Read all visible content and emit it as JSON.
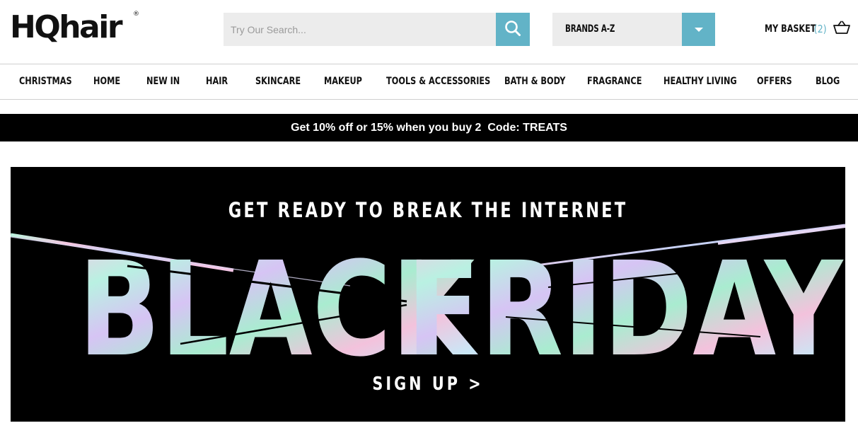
{
  "header": {
    "logo_text": "HQhair",
    "logo_mark": "®",
    "search_placeholder": "Try Our Search...",
    "search_icon": "search-icon",
    "brands_label": "BRANDS A-Z",
    "brands_icon": "chevron-down-icon",
    "basket_label": "MY BASKET",
    "basket_count": "(2)",
    "basket_icon": "basket-icon"
  },
  "nav": {
    "items": [
      {
        "label": "CHRISTMAS"
      },
      {
        "label": "HOME"
      },
      {
        "label": "NEW IN"
      },
      {
        "label": "HAIR"
      },
      {
        "label": "SKINCARE"
      },
      {
        "label": "MAKEUP"
      },
      {
        "label": "TOOLS & ACCESSORIES"
      },
      {
        "label": "BATH & BODY"
      },
      {
        "label": "FRAGRANCE"
      },
      {
        "label": "HEALTHY LIVING"
      },
      {
        "label": "OFFERS"
      },
      {
        "label": "BLOG"
      }
    ]
  },
  "promo": {
    "text": "Get 10% off or 15% when you buy 2  Code: TREATS"
  },
  "hero": {
    "tagline": "GET READY TO BREAK THE INTERNET",
    "headline_word1": "BLACK",
    "headline_word2": "FRIDAY",
    "signup_label": "SIGN UP >"
  },
  "colors": {
    "accent": "#62b3c7",
    "promo_bg": "#000000",
    "hero_bg": "#000000"
  }
}
